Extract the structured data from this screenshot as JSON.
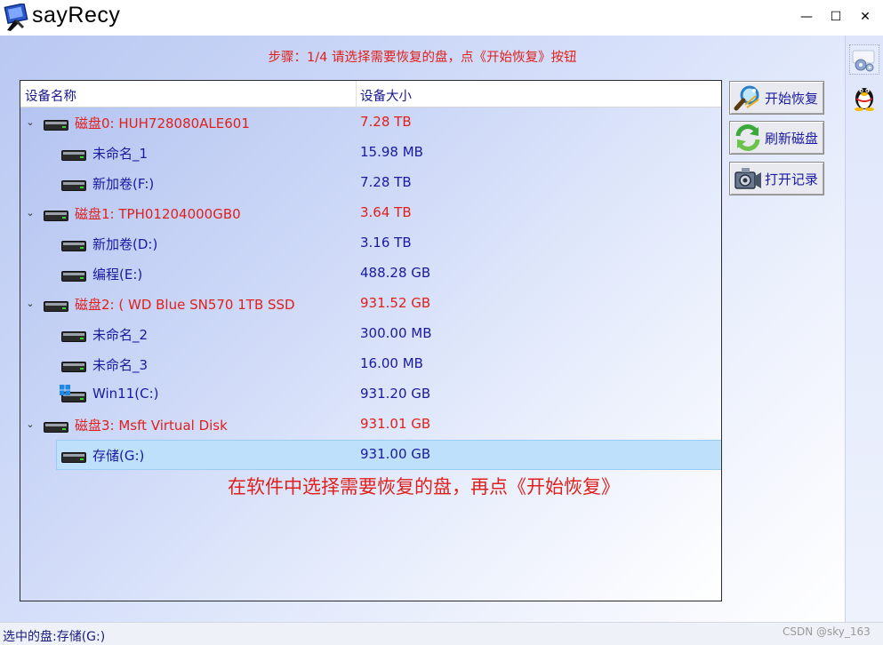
{
  "window": {
    "title": "sayRecy",
    "minimize": "—",
    "maximize": "☐",
    "close": "✕"
  },
  "step_text": "步骤：1/4 请选择需要恢复的盘，点《开始恢复》按钮",
  "tree": {
    "columns": [
      "设备名称",
      "设备大小"
    ],
    "rows": [
      {
        "level": 0,
        "label": "磁盘0: HUH728080ALE601",
        "size": "7.28 TB"
      },
      {
        "level": 1,
        "label": "未命名_1",
        "size": "15.98 MB"
      },
      {
        "level": 1,
        "label": "新加卷(F:)",
        "size": "7.28 TB"
      },
      {
        "level": 0,
        "label": "磁盘1: TPH01204000GB0",
        "size": "3.64 TB"
      },
      {
        "level": 1,
        "label": "新加卷(D:)",
        "size": "3.16 TB"
      },
      {
        "level": 1,
        "label": "编程(E:)",
        "size": "488.28 GB"
      },
      {
        "level": 0,
        "label": "磁盘2: ( WD Blue SN570 1TB SSD",
        "size": "931.52 GB"
      },
      {
        "level": 1,
        "label": "未命名_2",
        "size": "300.00 MB"
      },
      {
        "level": 1,
        "label": "未命名_3",
        "size": "16.00 MB"
      },
      {
        "level": 1,
        "label": "Win11(C:)",
        "size": "931.20 GB",
        "icon": "windows-icon"
      },
      {
        "level": 0,
        "label": "磁盘3: Msft     Virtual Disk",
        "size": "931.01 GB"
      },
      {
        "level": 1,
        "label": "存储(G:)",
        "size": "931.00 GB",
        "selected": true
      }
    ]
  },
  "annotation": "在软件中选择需要恢复的盘，再点《开始恢复》",
  "buttons": {
    "start": "开始恢复",
    "refresh": "刷新磁盘",
    "log": "打开记录"
  },
  "status": "选中的盘:存储(G:)",
  "watermark": "CSDN @sky_163",
  "colors": {
    "disk_text": "#e0201c",
    "partition_text": "#1a1aa0",
    "selection": "#bfe0fb"
  }
}
